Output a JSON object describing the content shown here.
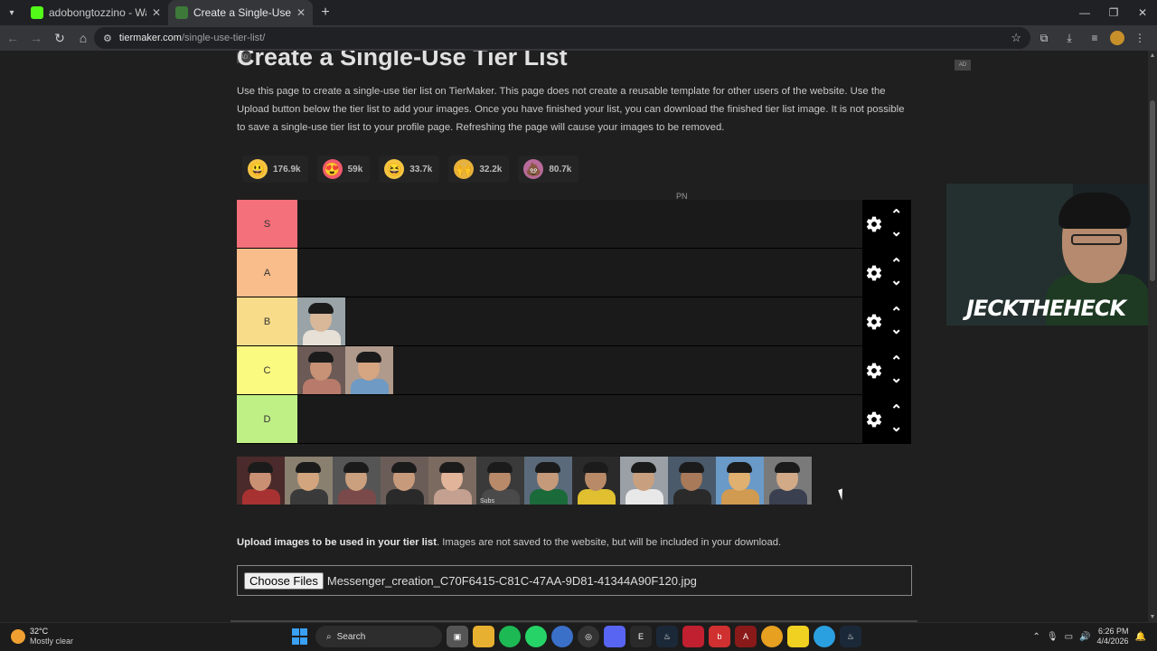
{
  "browser": {
    "tabs": [
      {
        "title": "adobongtozzino - Watch the V",
        "favicon_color": "#53fc18",
        "active": false
      },
      {
        "title": "Create a Single-Use Tier List (P",
        "favicon_color": "#3d7a3a",
        "active": true
      }
    ],
    "url_host": "tiermaker.com",
    "url_path": "/single-use-tier-list/"
  },
  "page": {
    "ad_label": "AD",
    "title": "Create a Single-Use Tier List",
    "intro": "Use this page to create a single-use tier list on TierMaker. This page does not create a reusable template for other users of the website. Use the Upload button below the tier list to add your images. Once you have finished your list, you can download the finished tier list image. It is not possible to save a single-use tier list to your profile page. Refreshing the page will cause your images to be removed.",
    "reactions": [
      {
        "icon": "grin-emoji",
        "glyph": "😃",
        "bg": "#f5c542",
        "count": "176.9k"
      },
      {
        "icon": "heart-eyes-emoji",
        "glyph": "😍",
        "bg": "#f05a6a",
        "count": "59k"
      },
      {
        "icon": "laugh-emoji",
        "glyph": "😆",
        "bg": "#f5c542",
        "count": "33.7k"
      },
      {
        "icon": "raised-hands-emoji",
        "glyph": "🙌",
        "bg": "#e8b23a",
        "count": "32.2k"
      },
      {
        "icon": "poop-emoji",
        "glyph": "💩",
        "bg": "#b86a9a",
        "count": "80.7k"
      }
    ],
    "pn_text": "PN",
    "tiers": [
      {
        "label": "S",
        "color": "#f4707a",
        "items": []
      },
      {
        "label": "A",
        "color": "#f8bd8a",
        "items": []
      },
      {
        "label": "B",
        "color": "#f8dc8a",
        "items": [
          {
            "bg": "#9aa4a8",
            "face": "#d9b89a",
            "body": "#e6e0d6"
          }
        ]
      },
      {
        "label": "C",
        "color": "#fbfa80",
        "items": [
          {
            "bg": "#6b5a55",
            "face": "#c79276",
            "body": "#b87a6a"
          },
          {
            "bg": "#b09a8c",
            "face": "#d6a582",
            "body": "#6e9ac4"
          }
        ]
      },
      {
        "label": "D",
        "color": "#bff086",
        "items": []
      }
    ],
    "pool": [
      {
        "bg": "#4a2a2a",
        "face": "#c99073",
        "body": "#a83232"
      },
      {
        "bg": "#8a8070",
        "face": "#d2a57e",
        "body": "#3a3a3a"
      },
      {
        "bg": "#555",
        "face": "#caa07f",
        "body": "#7a4a4a"
      },
      {
        "bg": "#6a5d58",
        "face": "#c89a7c",
        "body": "#2a2a2a"
      },
      {
        "bg": "#7a6a60",
        "face": "#e2b59a",
        "body": "#c4a090"
      },
      {
        "bg": "#3a3a3a",
        "face": "#b98a6a",
        "body": "#4a4a4a",
        "caption": "Subs"
      },
      {
        "bg": "#5a6a7a",
        "face": "#c49a7a",
        "body": "#1b6a3a"
      },
      {
        "bg": "#2a2a2a",
        "face": "#b88a68",
        "body": "#e0c030"
      },
      {
        "bg": "#9aa0a6",
        "face": "#c8a080",
        "body": "#e8e8e8"
      },
      {
        "bg": "#4a5a6a",
        "face": "#a87a5a",
        "body": "#2a2a2a"
      },
      {
        "bg": "#6a9ac8",
        "face": "#e0b070",
        "body": "#d09a50"
      },
      {
        "bg": "#7a7a7a",
        "face": "#d2aa88",
        "body": "#3a4050"
      }
    ],
    "upload_bold": "Upload images to be used in your tier list",
    "upload_rest": ". Images are not saved to the website, but will be included in your download.",
    "choose_files": "Choose Files",
    "file_name": "Messenger_creation_C70F6415-C81C-47AA-9D81-41344A90F120.jpg"
  },
  "stream_overlay": {
    "brand_1": "JECK",
    "brand_2": "THE",
    "brand_3": "HECK"
  },
  "taskbar": {
    "temp": "32°C",
    "weather": "Mostly clear",
    "search": "Search",
    "time": "6:26 PM",
    "date": "4/4/2026"
  }
}
